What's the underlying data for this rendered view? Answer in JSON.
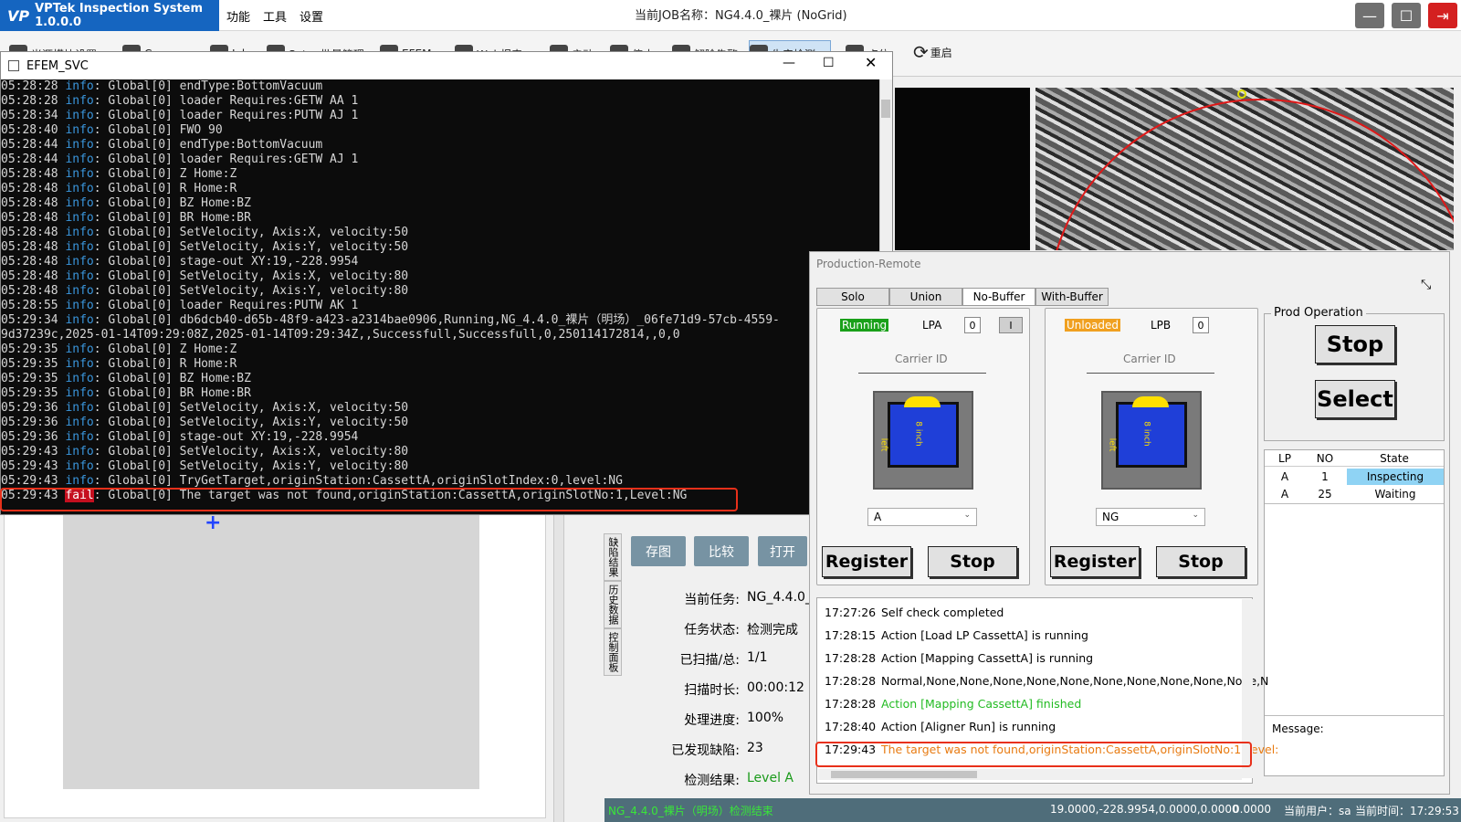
{
  "app": {
    "logo_mark": "VP",
    "title": "VPTek Inspection System 1.0.0.0",
    "menu": [
      "功能",
      "工具",
      "设置"
    ],
    "job_title": "当前JOB名称：NG4.4.0_裸片 (NoGrid)"
  },
  "toolbar": {
    "items": [
      "光源模块设置",
      "Camera",
      "Job",
      "Setup批量管理",
      "EFEM",
      "Web报表",
      "启动",
      "停止",
      "解除告警",
      "生产检测",
      "点位",
      "重启"
    ]
  },
  "console": {
    "title": "EFEM_SVC",
    "lines": [
      {
        "time": "05:28:28",
        "level": "info",
        "msg": ": Global[0] endType:BottomVacuum"
      },
      {
        "time": "05:28:28",
        "level": "info",
        "msg": ": Global[0] loader Requires:GETW AA 1"
      },
      {
        "time": "05:28:34",
        "level": "info",
        "msg": ": Global[0] loader Requires:PUTW AJ 1"
      },
      {
        "time": "05:28:40",
        "level": "info",
        "msg": ": Global[0] FWO 90"
      },
      {
        "time": "05:28:44",
        "level": "info",
        "msg": ": Global[0] endType:BottomVacuum"
      },
      {
        "time": "05:28:44",
        "level": "info",
        "msg": ": Global[0] loader Requires:GETW AJ 1"
      },
      {
        "time": "05:28:48",
        "level": "info",
        "msg": ": Global[0] Z Home:Z"
      },
      {
        "time": "05:28:48",
        "level": "info",
        "msg": ": Global[0] R Home:R"
      },
      {
        "time": "05:28:48",
        "level": "info",
        "msg": ": Global[0] BZ Home:BZ"
      },
      {
        "time": "05:28:48",
        "level": "info",
        "msg": ": Global[0] BR Home:BR"
      },
      {
        "time": "05:28:48",
        "level": "info",
        "msg": ": Global[0] SetVelocity, Axis:X, velocity:50"
      },
      {
        "time": "05:28:48",
        "level": "info",
        "msg": ": Global[0] SetVelocity, Axis:Y, velocity:50"
      },
      {
        "time": "05:28:48",
        "level": "info",
        "msg": ": Global[0] stage-out XY:19,-228.9954"
      },
      {
        "time": "05:28:48",
        "level": "info",
        "msg": ": Global[0] SetVelocity, Axis:X, velocity:80"
      },
      {
        "time": "05:28:48",
        "level": "info",
        "msg": ": Global[0] SetVelocity, Axis:Y, velocity:80"
      },
      {
        "time": "05:28:55",
        "level": "info",
        "msg": ": Global[0] loader Requires:PUTW AK 1"
      },
      {
        "time": "05:29:34",
        "level": "info",
        "msg": ": Global[0] db6dcb40-d65b-48f9-a423-a2314bae0906,Running,NG_4.4.0_裸片（明场）_06fe71d9-57cb-4559-"
      },
      {
        "time": "",
        "level": "",
        "msg": "9d37239c,2025-01-14T09:29:08Z,2025-01-14T09:29:34Z,,Successfull,Successfull,0,250114172814,,0,0"
      },
      {
        "time": "05:29:35",
        "level": "info",
        "msg": ": Global[0] Z Home:Z"
      },
      {
        "time": "05:29:35",
        "level": "info",
        "msg": ": Global[0] R Home:R"
      },
      {
        "time": "05:29:35",
        "level": "info",
        "msg": ": Global[0] BZ Home:BZ"
      },
      {
        "time": "05:29:35",
        "level": "info",
        "msg": ": Global[0] BR Home:BR"
      },
      {
        "time": "05:29:36",
        "level": "info",
        "msg": ": Global[0] SetVelocity, Axis:X, velocity:50"
      },
      {
        "time": "05:29:36",
        "level": "info",
        "msg": ": Global[0] SetVelocity, Axis:Y, velocity:50"
      },
      {
        "time": "05:29:36",
        "level": "info",
        "msg": ": Global[0] stage-out XY:19,-228.9954"
      },
      {
        "time": "05:29:43",
        "level": "info",
        "msg": ": Global[0] SetVelocity, Axis:X, velocity:80"
      },
      {
        "time": "05:29:43",
        "level": "info",
        "msg": ": Global[0] SetVelocity, Axis:Y, velocity:80"
      },
      {
        "time": "05:29:43",
        "level": "info",
        "msg": ": Global[0] TryGetTarget,originStation:CassettA,originSlotIndex:0,level:NG"
      },
      {
        "time": "05:29:43",
        "level": "fail",
        "msg": ": Global[0] The target was not found,originStation:CassettA,originSlotNo:1,Level:NG"
      }
    ]
  },
  "side_tabs": [
    "缺陷结果",
    "历史数据",
    "控制面板"
  ],
  "actions": [
    "存图",
    "比较",
    "打开"
  ],
  "info": {
    "rows": [
      {
        "label": "当前任务:",
        "value": "NG_4.4.0_"
      },
      {
        "label": "任务状态:",
        "value": "检测完成"
      },
      {
        "label": "已扫描/总:",
        "value": "1/1"
      },
      {
        "label": "扫描时长:",
        "value": "00:00:12"
      },
      {
        "label": "处理进度:",
        "value": "100%"
      },
      {
        "label": "已发现缺陷:",
        "value": "23"
      },
      {
        "label": "检测结果:",
        "value": "Level A"
      }
    ],
    "result_color": "#1a9a1a"
  },
  "status_bar": {
    "task": "NG_4.4.0_裸片（明场）检测结束",
    "coords": "19.0000,-228.9954,0.0000,0.0000",
    "zero": "0.0000",
    "user": "当前用户：sa",
    "time": "当前时间：17:29:53"
  },
  "production": {
    "title": "Production-Remote",
    "tabs": [
      "Solo",
      "Union",
      "No-Buffer",
      "With-Buffer"
    ],
    "lpa": {
      "status": "Running",
      "status_color": "#1aa01a",
      "label": "LPA",
      "count": "0",
      "flag": "I",
      "carrier_label": "Carrier ID",
      "combo": "A",
      "register": "Register",
      "stop": "Stop",
      "carrier_text": "8 inch",
      "carrier_side": "left"
    },
    "lpb": {
      "status": "Unloaded",
      "status_color": "#f0a020",
      "label": "LPB",
      "count": "0",
      "carrier_label": "Carrier ID",
      "combo": "NG",
      "register": "Register",
      "stop": "Stop",
      "carrier_text": "8 inch",
      "carrier_side": "left"
    },
    "prod_op": {
      "label": "Prod Operation",
      "stop": "Stop",
      "select": "Select"
    },
    "table": {
      "headers": [
        "LP",
        "NO",
        "State"
      ],
      "rows": [
        {
          "lp": "A",
          "no": "1",
          "state": "Inspecting",
          "highlight": "#8fd3f4"
        },
        {
          "lp": "A",
          "no": "25",
          "state": "Waiting",
          "highlight": ""
        }
      ]
    },
    "message_label": "Message:",
    "log": [
      {
        "time": "17:27:26",
        "msg": "Self check completed",
        "color": "#000000"
      },
      {
        "time": "17:28:15",
        "msg": "Action [Load LP CassettA] is running",
        "color": "#000000"
      },
      {
        "time": "17:28:28",
        "msg": "Action [Mapping CassettA] is running",
        "color": "#000000"
      },
      {
        "time": "17:28:28",
        "msg": "Normal,None,None,None,None,None,None,None,None,None,None,N",
        "color": "#000000"
      },
      {
        "time": "17:28:28",
        "msg": "Action [Mapping CassettA] finished",
        "color": "#22bb22"
      },
      {
        "time": "17:28:40",
        "msg": "Action [Aligner Run] is running",
        "color": "#000000"
      },
      {
        "time": "17:29:43",
        "msg": "The target was not found,originStation:CassettA,originSlotNo:1,Level:",
        "color": "#e87a10"
      }
    ]
  }
}
